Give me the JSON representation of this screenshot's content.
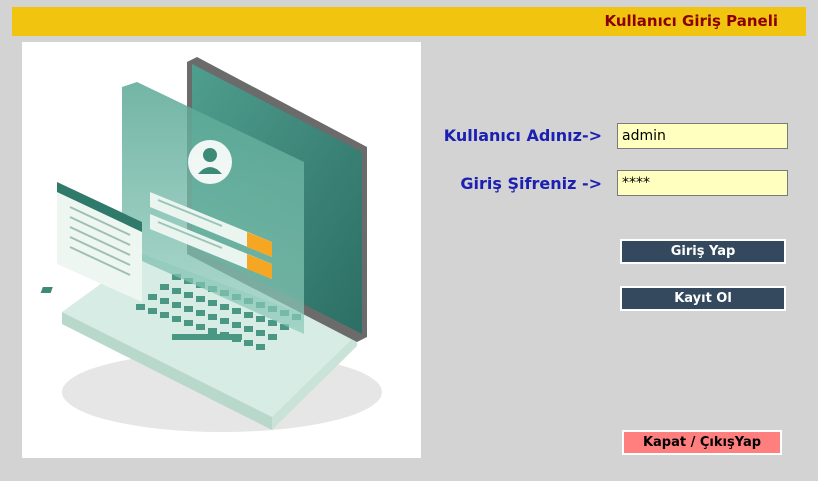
{
  "header": {
    "title": "Kullanıcı Giriş Paneli"
  },
  "form": {
    "username_label": "Kullanıcı Adınız->",
    "username_value": "admin",
    "password_label": "Giriş Şifreniz ->",
    "password_value": "****"
  },
  "buttons": {
    "login": "Giriş Yap",
    "register": "Kayıt Ol",
    "exit": "Kapat / ÇıkışYap"
  },
  "illustration": {
    "icon": "laptop-login-illustration"
  },
  "colors": {
    "header_bg": "#f1c40f",
    "header_text": "#8b0000",
    "label_text": "#1c20b0",
    "field_bg": "#ffffc0",
    "button_dark": "#34495e",
    "button_exit": "#ff7f7f",
    "background": "#d3d3d3"
  }
}
